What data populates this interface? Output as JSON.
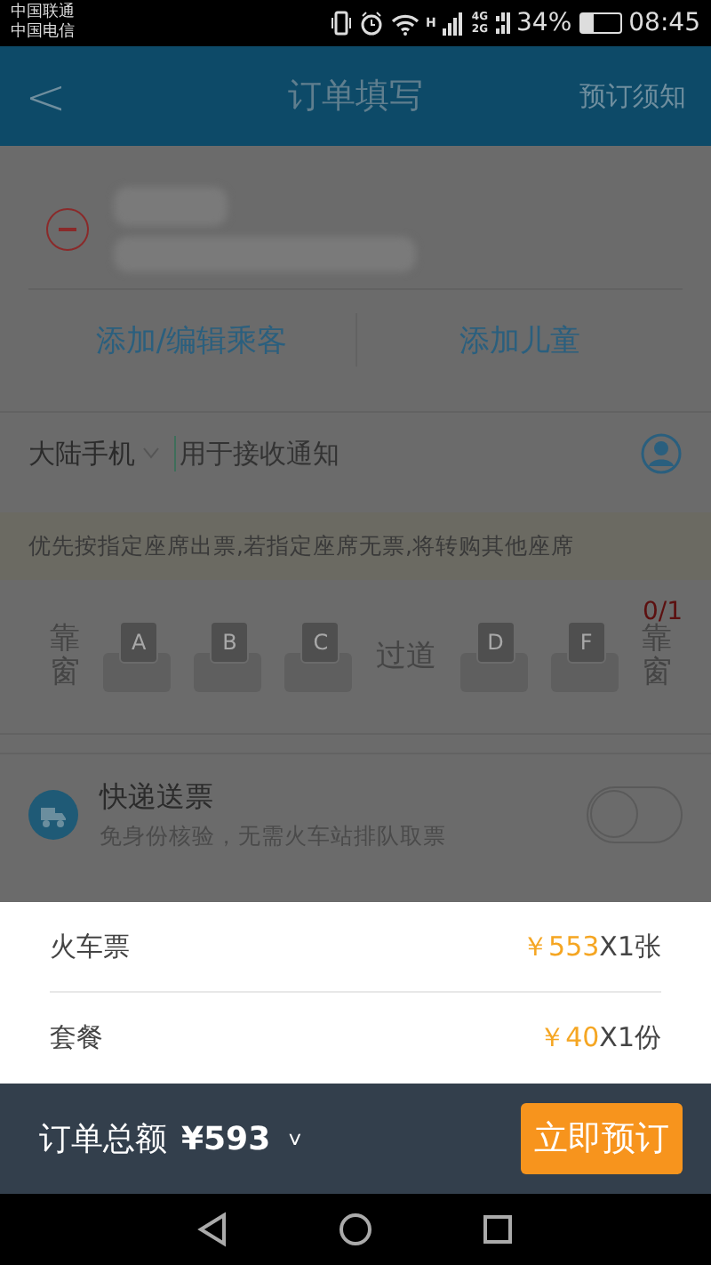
{
  "status_bar": {
    "carriers": [
      "中国联通",
      "中国电信"
    ],
    "network_labels": [
      "H",
      "4G",
      "2G"
    ],
    "battery": "34%",
    "time": "08:45"
  },
  "header": {
    "back": "<",
    "title": "订单填写",
    "action": "预订须知"
  },
  "passenger_actions": [
    "添加/编辑乘客",
    "添加儿童"
  ],
  "phone": {
    "region": "大陆手机",
    "placeholder": "用于接收通知"
  },
  "notice": "优先按指定座席出票,若指定座席无票,将转购其他座席",
  "seats": {
    "count": "0/1",
    "items": [
      {
        "kind": "label",
        "text": "靠窗"
      },
      {
        "kind": "seat",
        "text": "A",
        "selected": false
      },
      {
        "kind": "seat",
        "text": "B",
        "selected": false
      },
      {
        "kind": "seat",
        "text": "C",
        "selected": false
      },
      {
        "kind": "label",
        "text": "过道"
      },
      {
        "kind": "seat",
        "text": "D",
        "selected": false
      },
      {
        "kind": "seat",
        "text": "F",
        "selected": false
      },
      {
        "kind": "label",
        "text": "靠窗"
      }
    ]
  },
  "delivery": {
    "title": "快递送票",
    "subtitle": "免身份核验，无需火车站排队取票",
    "on": false
  },
  "price_details": [
    {
      "label": "火车票",
      "price": "￥553",
      "quantity": "X1张"
    },
    {
      "label": "套餐",
      "price": "￥40",
      "quantity": "X1份"
    }
  ],
  "footer": {
    "label": "订单总额",
    "total": "¥593",
    "expand": "˅",
    "button": "立即预订"
  }
}
